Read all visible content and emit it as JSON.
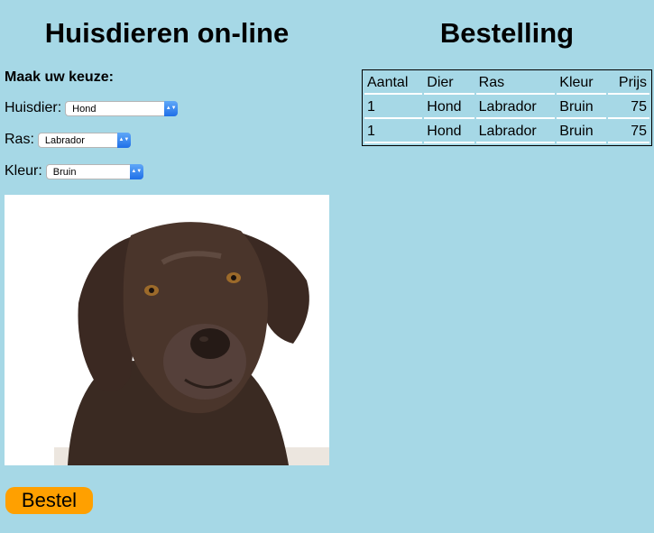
{
  "left": {
    "title": "Huisdieren on-line",
    "prompt": "Maak uw keuze:",
    "fields": [
      {
        "label": "Huisdier:",
        "value": "Hond"
      },
      {
        "label": "Ras:",
        "value": "Labrador"
      },
      {
        "label": "Kleur:",
        "value": "Bruin"
      }
    ],
    "button": "Bestel"
  },
  "right": {
    "title": "Bestelling",
    "headers": [
      "Aantal",
      "Dier",
      "Ras",
      "Kleur",
      "Prijs"
    ],
    "rows": [
      [
        "1",
        "Hond",
        "Labrador",
        "Bruin",
        "75"
      ],
      [
        "1",
        "Hond",
        "Labrador",
        "Bruin",
        "75"
      ]
    ]
  },
  "image": {
    "subject": "chocolate labrador dog photo"
  },
  "colors": {
    "background": "#a6d8e6",
    "button": "#ffa000",
    "select_arrow": "#1f6fe8"
  }
}
